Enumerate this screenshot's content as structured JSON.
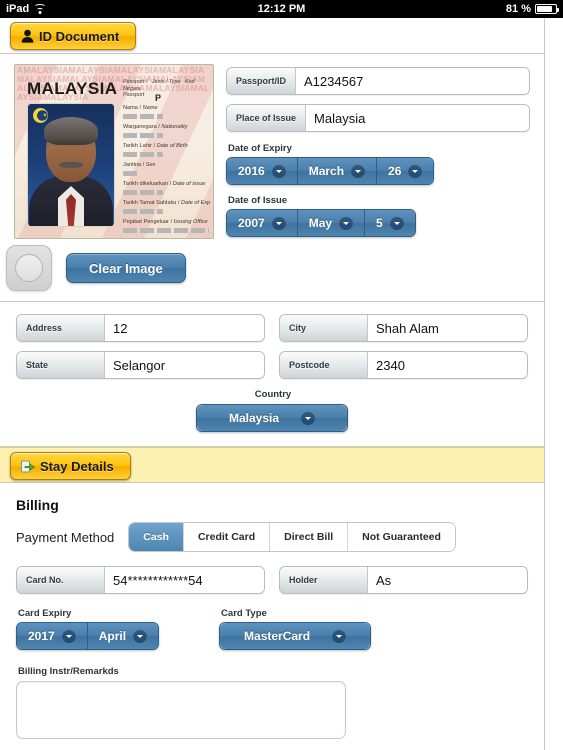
{
  "statusbar": {
    "device": "iPad",
    "time": "12:12 PM",
    "battery": "81 %"
  },
  "tabs": {
    "id_document": {
      "label": "ID Document",
      "icon": "person-icon"
    },
    "stay_details": {
      "label": "Stay Details",
      "icon": "green-arrow-icon"
    }
  },
  "id_card": {
    "country": "MALAYSIA",
    "watermark": "AMALAYSIAMALAYSIAMALAYSIAMALAYSIAMALAYSIAMALAYSIAMALAYSIAMALAYSIAMALAYSIAMALAYSIAMALAYSIAMALAYSIAMALAYSIAMALAYSIA",
    "header_line1": "Passport /",
    "header_line2": "Passport",
    "header_type": "Jenis / Type",
    "header_code": "Kod Negara",
    "passport_type": "P",
    "fields": [
      {
        "label_ms": "Nama",
        "label_en": "Name"
      },
      {
        "label_ms": "Warganegara",
        "label_en": "Nationality"
      },
      {
        "label_ms": "Tarikh Lahir",
        "label_en": "Date of Birth"
      },
      {
        "label_ms": "Jantina",
        "label_en": "Sex"
      },
      {
        "label_ms": "Tarikh dikeluarkan",
        "label_en": "Date of issue"
      },
      {
        "label_ms": "Tarikh Tamat Sahlaku",
        "label_en": "Date of Exp"
      },
      {
        "label_ms": "Pejabat Pengeluar",
        "label_en": "Issuing Office"
      }
    ]
  },
  "id_form": {
    "passport_label": "Passport/ID",
    "passport_value": "A1234567",
    "place_label": "Place of Issue",
    "place_value": "Malaysia",
    "expiry_title": "Date of Expiry",
    "expiry_year": "2016",
    "expiry_month": "March",
    "expiry_day": "26",
    "issue_title": "Date of Issue",
    "issue_year": "2007",
    "issue_month": "May",
    "issue_day": "5",
    "clear_image": "Clear Image"
  },
  "address": {
    "address_label": "Address",
    "address_value": "12",
    "city_label": "City",
    "city_value": "Shah Alam",
    "state_label": "State",
    "state_value": "Selangor",
    "postcode_label": "Postcode",
    "postcode_value": "2340",
    "country_title": "Country",
    "country_value": "Malaysia"
  },
  "billing": {
    "title": "Billing",
    "payment_method_label": "Payment Method",
    "payment_options": [
      "Cash",
      "Credit Card",
      "Direct Bill",
      "Not Guaranteed"
    ],
    "payment_selected": "Cash",
    "card_no_label": "Card No.",
    "card_no_value": "54************54",
    "holder_label": "Holder",
    "holder_value": "As",
    "card_expiry_title": "Card Expiry",
    "card_expiry_year": "2017",
    "card_expiry_month": "April",
    "card_type_title": "Card Type",
    "card_type_value": "MasterCard",
    "remarks_title": "Billing Instr/Remarkds",
    "remarks_value": ""
  }
}
